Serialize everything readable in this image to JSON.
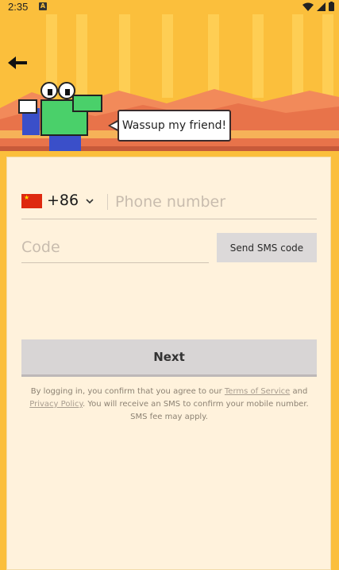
{
  "status_bar": {
    "time": "2:35",
    "app_icon_letter": "A"
  },
  "hero": {
    "speech_bubble": "Wassup my friend!"
  },
  "form": {
    "country_code": "+86",
    "phone_placeholder": "Phone number",
    "code_placeholder": "Code",
    "send_sms_label": "Send SMS code",
    "next_label": "Next"
  },
  "legal": {
    "prefix": "By logging in, you confirm that you agree to our ",
    "terms_label": "Terms of Service",
    "and": " and ",
    "privacy_label": "Privacy Policy",
    "suffix": ". You will receive an SMS to confirm your mobile number. SMS fee may apply."
  },
  "colors": {
    "background": "#fbbf3c",
    "card": "#fff2dc",
    "button_gray": "#dcd9d9",
    "flag_red": "#de2910"
  },
  "icons": [
    "back-arrow-icon",
    "wifi-icon",
    "cellular-icon",
    "battery-icon",
    "chevron-down-icon",
    "china-flag-icon",
    "crocodile-mascot"
  ]
}
